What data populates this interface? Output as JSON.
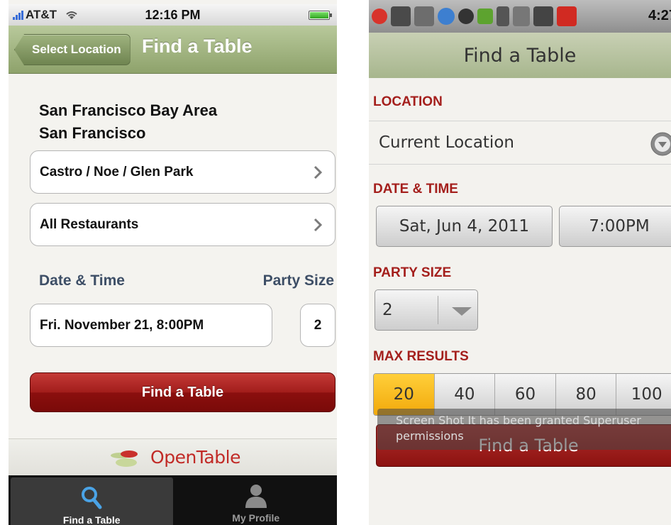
{
  "ios": {
    "status": {
      "carrier": "AT&T",
      "time": "12:16 PM"
    },
    "nav": {
      "back_label": "Select Location",
      "title": "Find a Table"
    },
    "region": "San Francisco Bay Area",
    "city": "San Francisco",
    "neighborhood": "Castro / Noe / Glen Park",
    "restaurants": "All Restaurants",
    "date_time_label": "Date & Time",
    "party_size_label": "Party Size",
    "date_time_value": "Fri. November 21, 8:00PM",
    "party_size_value": "2",
    "find_button": "Find a Table",
    "brand": "OpenTable",
    "tabs": [
      {
        "label": "Find a Table",
        "icon": "search-icon"
      },
      {
        "label": "My Profile",
        "icon": "person-icon"
      }
    ],
    "colors": {
      "nav": "#8ea26b",
      "find_button": "#a21d1b",
      "label": "#3d4e66",
      "brand": "#c12a26"
    }
  },
  "android": {
    "status": {
      "time": "4:27"
    },
    "header_title": "Find a Table",
    "location_label": "LOCATION",
    "location_value": "Current Location",
    "date_time_label": "DATE & TIME",
    "date_value": "Sat, Jun 4, 2011",
    "time_value": "7:00PM",
    "party_size_label": "PARTY SIZE",
    "party_size_value": "2",
    "max_results_label": "MAX RESULTS",
    "max_results_options": [
      "20",
      "40",
      "60",
      "80",
      "100"
    ],
    "max_results_selected": "20",
    "toast_message": "Screen Shot It has been granted Superuser permissions",
    "find_button": "Find a Table",
    "colors": {
      "label": "#a41f1c",
      "selected_segment": "#f2a90b",
      "find_button": "#8c1210"
    }
  }
}
